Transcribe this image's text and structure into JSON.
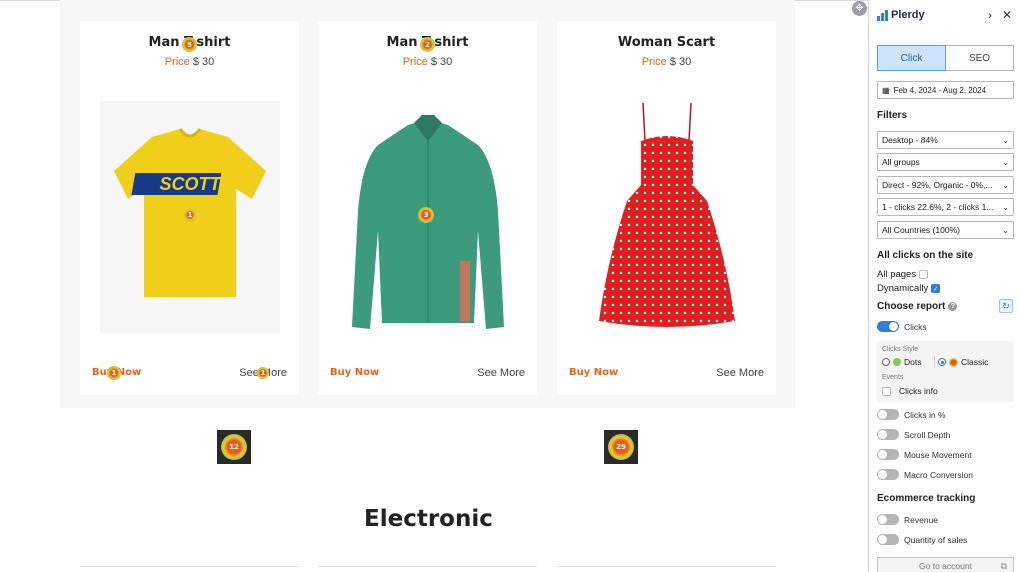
{
  "products": [
    {
      "title": "Man T-shirt",
      "price_label": "Price",
      "price_value": "$ 30",
      "buy": "Buy Now",
      "more": "See More"
    },
    {
      "title": "Man T-shirt",
      "price_label": "Price",
      "price_value": "$ 30",
      "buy": "Buy Now",
      "more": "See More"
    },
    {
      "title": "Woman Scart",
      "price_label": "Price",
      "price_value": "$ 30",
      "buy": "Buy Now",
      "more": "See More"
    }
  ],
  "heatmap_counts": {
    "card1_title": "5",
    "card1_image": "1",
    "card1_buy": "1",
    "card1_more": "1",
    "card2_title": "2",
    "card2_image": "3",
    "below_left": "12",
    "below_right": "29"
  },
  "section_title": "Electronic",
  "panel": {
    "brand": "Plerdy",
    "tabs": [
      "Click",
      "SEO"
    ],
    "date_range": "Feb 4, 2024 - Aug 2, 2024",
    "filters_title": "Filters",
    "filters": [
      "Desktop - 84%",
      "All groups",
      "Direct - 92%, Organic - 0%,...",
      "1 - clicks 22.6%, 2 - clicks 1...",
      "All Countries (100%)"
    ],
    "all_clicks_title": "All clicks on the site",
    "all_pages": "All pages",
    "dynamically": "Dynamically",
    "choose_report": "Choose report",
    "clicks": "Clicks",
    "clicks_style_label": "Clicks Style",
    "style_dots": "Dots",
    "style_classic": "Classic",
    "events_label": "Events",
    "clicks_info": "Clicks info",
    "toggles": [
      "Clicks in %",
      "Scroll Depth",
      "Mouse Movement",
      "Macro Conversion"
    ],
    "ecommerce_title": "Ecommerce tracking",
    "ecommerce_toggles": [
      "Revenue",
      "Quantity of sales"
    ],
    "go_account": "Go to account"
  },
  "colors": {
    "accent": "#e8631a",
    "panel_blue": "#2f7de1"
  }
}
